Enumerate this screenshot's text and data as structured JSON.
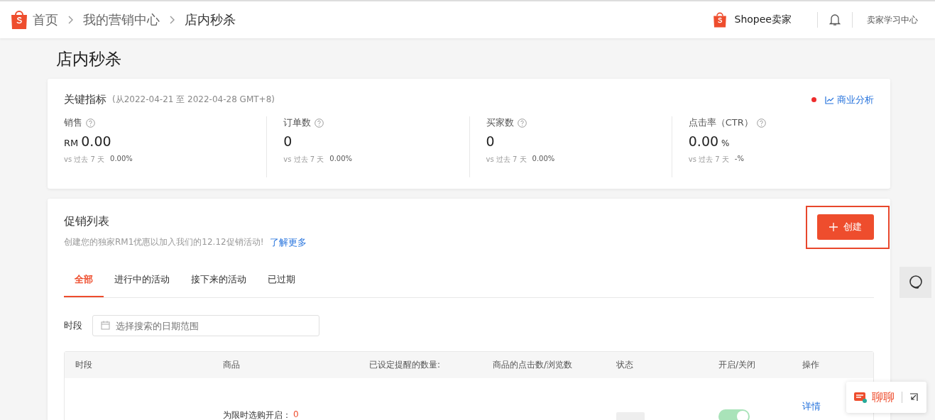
{
  "breadcrumb": [
    {
      "label": "首页",
      "current": false
    },
    {
      "label": "我的营销中心",
      "current": false
    },
    {
      "label": "店内秒杀",
      "current": true
    }
  ],
  "header": {
    "brand": "Shopee卖家",
    "learning_center": "卖家学习中心"
  },
  "page_title": "店内秒杀",
  "metrics": {
    "title": "关键指标",
    "range": "(从2022-04-21 至 2022-04-28 GMT+8)",
    "analysis_link": "商业分析",
    "items": [
      {
        "label": "销售",
        "prefix": "RM",
        "value": "0.00",
        "compare": "vs 过去 7 天",
        "change": "0.00%"
      },
      {
        "label": "订单数",
        "value": "0",
        "compare": "vs 过去 7 天",
        "change": "0.00%"
      },
      {
        "label": "买家数",
        "value": "0",
        "compare": "vs 过去 7 天",
        "change": "0.00%"
      },
      {
        "label": "点击率（CTR）",
        "value": "0.00",
        "suffix": "%",
        "compare": "vs 过去 7 天",
        "change": "-%"
      }
    ]
  },
  "promotions": {
    "title": "促销列表",
    "description": "创建您的独家RM1优惠以加入我们的12.12促销活动!",
    "learn_more": "了解更多",
    "create_button": "创建",
    "tabs": [
      {
        "label": "全部",
        "selected": true
      },
      {
        "label": "进行中的活动",
        "selected": false
      },
      {
        "label": "接下来的活动",
        "selected": false
      },
      {
        "label": "已过期",
        "selected": false
      }
    ],
    "filter": {
      "label": "时段",
      "placeholder": "选择搜索的日期范围"
    },
    "table": {
      "columns": [
        "时段",
        "商品",
        "已设定提醒的数量:",
        "商品的点击数/浏览数",
        "状态",
        "开启/关闭",
        "操作"
      ],
      "rows": [
        {
          "product_label": "为限时选购开启：",
          "product_count": "0",
          "enabled": true,
          "action": "详情"
        }
      ]
    }
  },
  "chat": {
    "label": "聊聊"
  }
}
